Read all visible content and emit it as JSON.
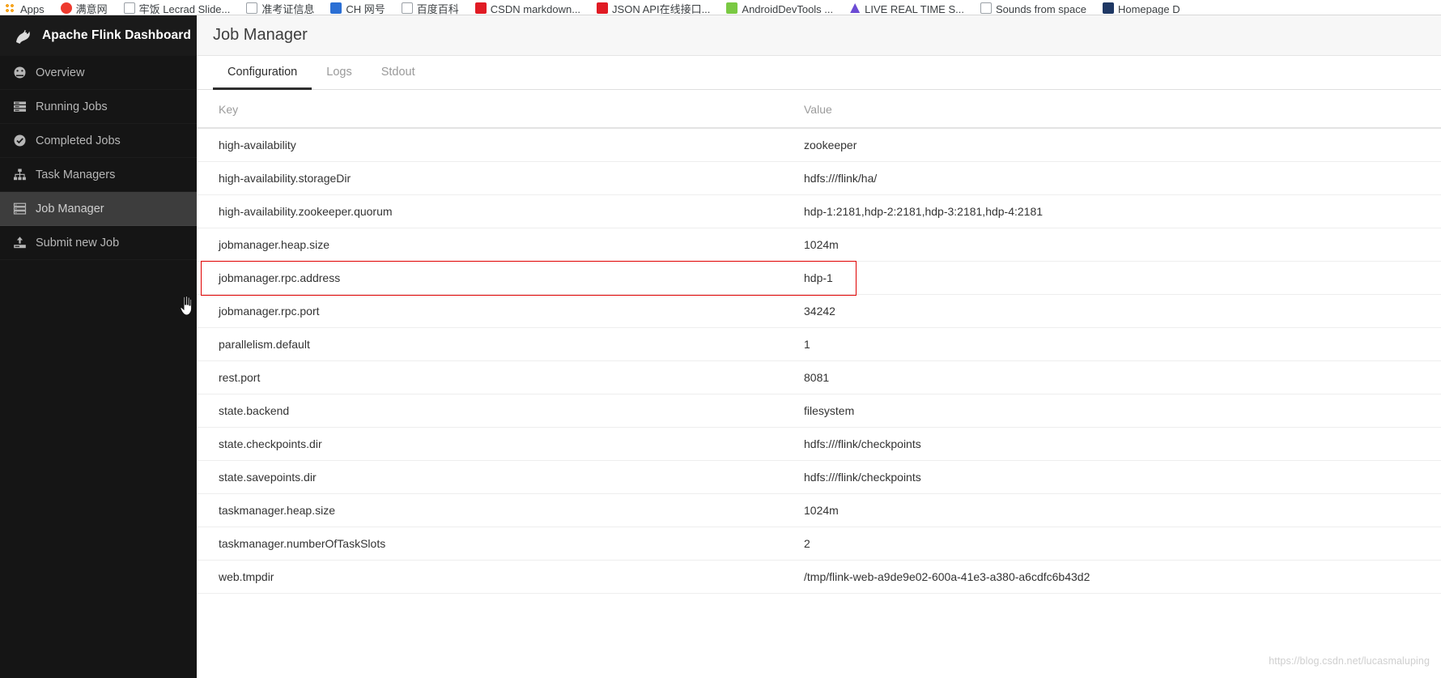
{
  "browser": {
    "bookmarks": [
      {
        "label": "Apps",
        "icon": "apps-grid-icon",
        "style": "ico-apps"
      },
      {
        "label": "满意网",
        "icon": "chat-bubble-icon",
        "style": "ico-chat"
      },
      {
        "label": "牢饭 Lecrad Slide...",
        "icon": "document-icon",
        "style": "ico-doc"
      },
      {
        "label": "准考证信息",
        "icon": "document-icon",
        "style": "ico-doc"
      },
      {
        "label": "CH 网号",
        "icon": "baidu-icon",
        "style": "ico-blue"
      },
      {
        "label": "百度百科",
        "icon": "document-icon",
        "style": "ico-doc"
      },
      {
        "label": "CSDN markdown...",
        "icon": "csdn-icon",
        "style": "ico-red"
      },
      {
        "label": "JSON API在线接口...",
        "icon": "csdn-icon",
        "style": "ico-red"
      },
      {
        "label": "AndroidDevTools ...",
        "icon": "android-icon",
        "style": "ico-green"
      },
      {
        "label": "LIVE REAL TIME S...",
        "icon": "triangle-icon",
        "style": "ico-violet"
      },
      {
        "label": "Sounds from space",
        "icon": "document-icon",
        "style": "ico-doc"
      },
      {
        "label": "Homepage D",
        "icon": "site-icon",
        "style": "ico-navy"
      }
    ]
  },
  "sidebar": {
    "brand_title": "Apache Flink Dashboard",
    "brand_icon": "flink-squirrel-logo",
    "items": [
      {
        "label": "Overview",
        "icon": "dashboard-gauge-icon",
        "active": false
      },
      {
        "label": "Running Jobs",
        "icon": "list-lines-icon",
        "active": false
      },
      {
        "label": "Completed Jobs",
        "icon": "check-circle-icon",
        "active": false
      },
      {
        "label": "Task Managers",
        "icon": "sitemap-icon",
        "active": false
      },
      {
        "label": "Job Manager",
        "icon": "server-stack-icon",
        "active": true
      },
      {
        "label": "Submit new Job",
        "icon": "upload-icon",
        "active": false
      }
    ]
  },
  "header": {
    "title": "Job Manager"
  },
  "tabs": [
    {
      "label": "Configuration",
      "active": true
    },
    {
      "label": "Logs",
      "active": false
    },
    {
      "label": "Stdout",
      "active": false
    }
  ],
  "table": {
    "columns": [
      "Key",
      "Value"
    ],
    "rows": [
      {
        "key": "high-availability",
        "value": "zookeeper"
      },
      {
        "key": "high-availability.storageDir",
        "value": "hdfs:///flink/ha/"
      },
      {
        "key": "high-availability.zookeeper.quorum",
        "value": "hdp-1:2181,hdp-2:2181,hdp-3:2181,hdp-4:2181"
      },
      {
        "key": "jobmanager.heap.size",
        "value": "1024m"
      },
      {
        "key": "jobmanager.rpc.address",
        "value": "hdp-1"
      },
      {
        "key": "jobmanager.rpc.port",
        "value": "34242"
      },
      {
        "key": "parallelism.default",
        "value": "1"
      },
      {
        "key": "rest.port",
        "value": "8081"
      },
      {
        "key": "state.backend",
        "value": "filesystem"
      },
      {
        "key": "state.checkpoints.dir",
        "value": "hdfs:///flink/checkpoints"
      },
      {
        "key": "state.savepoints.dir",
        "value": "hdfs:///flink/checkpoints"
      },
      {
        "key": "taskmanager.heap.size",
        "value": "1024m"
      },
      {
        "key": "taskmanager.numberOfTaskSlots",
        "value": "2"
      },
      {
        "key": "web.tmpdir",
        "value": "/tmp/flink-web-a9de9e02-600a-41e3-a380-a6cdfc6b43d2"
      }
    ]
  },
  "annotation": {
    "highlight_row_key": "jobmanager.rpc.address",
    "highlight_color": "#e00000"
  },
  "watermark": {
    "text": "https://blog.csdn.net/lucasmaluping"
  },
  "colors": {
    "sidebar_bg": "#151515",
    "sidebar_active_bg": "#3d3d3d",
    "header_bg": "#f7f7f7",
    "text_primary": "#333333",
    "text_muted": "#9b9b9b"
  }
}
